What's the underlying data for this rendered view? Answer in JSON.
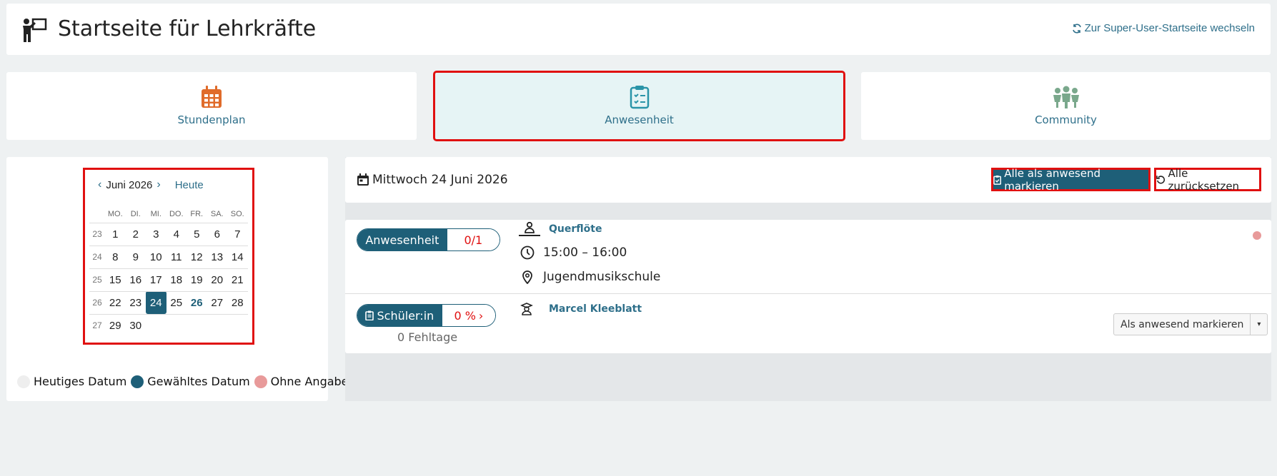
{
  "header": {
    "title": "Startseite für Lehrkräfte",
    "switch_label": "Zur Super-User-Startseite wechseln"
  },
  "tiles": [
    {
      "label": "Stundenplan",
      "icon": "calendar-icon",
      "color": "#e06b2a"
    },
    {
      "label": "Anwesenheit",
      "icon": "clipboard-check-icon",
      "color": "#2a94a8",
      "active": true
    },
    {
      "label": "Community",
      "icon": "people-icon",
      "color": "#7aa88c"
    }
  ],
  "calendar": {
    "month_label": "Juni 2026",
    "today_label": "Heute",
    "weekdays": [
      "MO.",
      "DI.",
      "MI.",
      "DO.",
      "FR.",
      "SA.",
      "SO."
    ],
    "weeks": [
      {
        "wk": "23",
        "days": [
          "1",
          "2",
          "3",
          "4",
          "5",
          "6",
          "7"
        ]
      },
      {
        "wk": "24",
        "days": [
          "8",
          "9",
          "10",
          "11",
          "12",
          "13",
          "14"
        ]
      },
      {
        "wk": "25",
        "days": [
          "15",
          "16",
          "17",
          "18",
          "19",
          "20",
          "21"
        ]
      },
      {
        "wk": "26",
        "days": [
          "22",
          "23",
          "24",
          "25",
          "26",
          "27",
          "28"
        ]
      },
      {
        "wk": "27",
        "days": [
          "29",
          "30",
          "",
          "",
          "",
          "",
          ""
        ]
      }
    ],
    "selected": "24",
    "today": "26"
  },
  "legend": [
    {
      "label": "Heutiges Datum",
      "color": "#eeeeee"
    },
    {
      "label": "Gewähltes Datum",
      "color": "#1e5f78"
    },
    {
      "label": "Ohne Angabe",
      "color": "#e89a9a"
    }
  ],
  "main": {
    "date": "Mittwoch 24 Juni 2026",
    "mark_all_label": "Alle als anwesend markieren",
    "reset_all_label": "Alle zurücksetzen"
  },
  "lesson": {
    "attendance_label": "Anwesenheit",
    "attendance_count": "0/1",
    "instrument": "Querflöte",
    "time": "15:00 – 16:00",
    "location": "Jugendmusikschule"
  },
  "student": {
    "label": "Schüler:in",
    "percent": "0 %",
    "name": "Marcel Kleeblatt",
    "absences": "0 Fehltage",
    "mark_label": "Als anwesend markieren"
  }
}
